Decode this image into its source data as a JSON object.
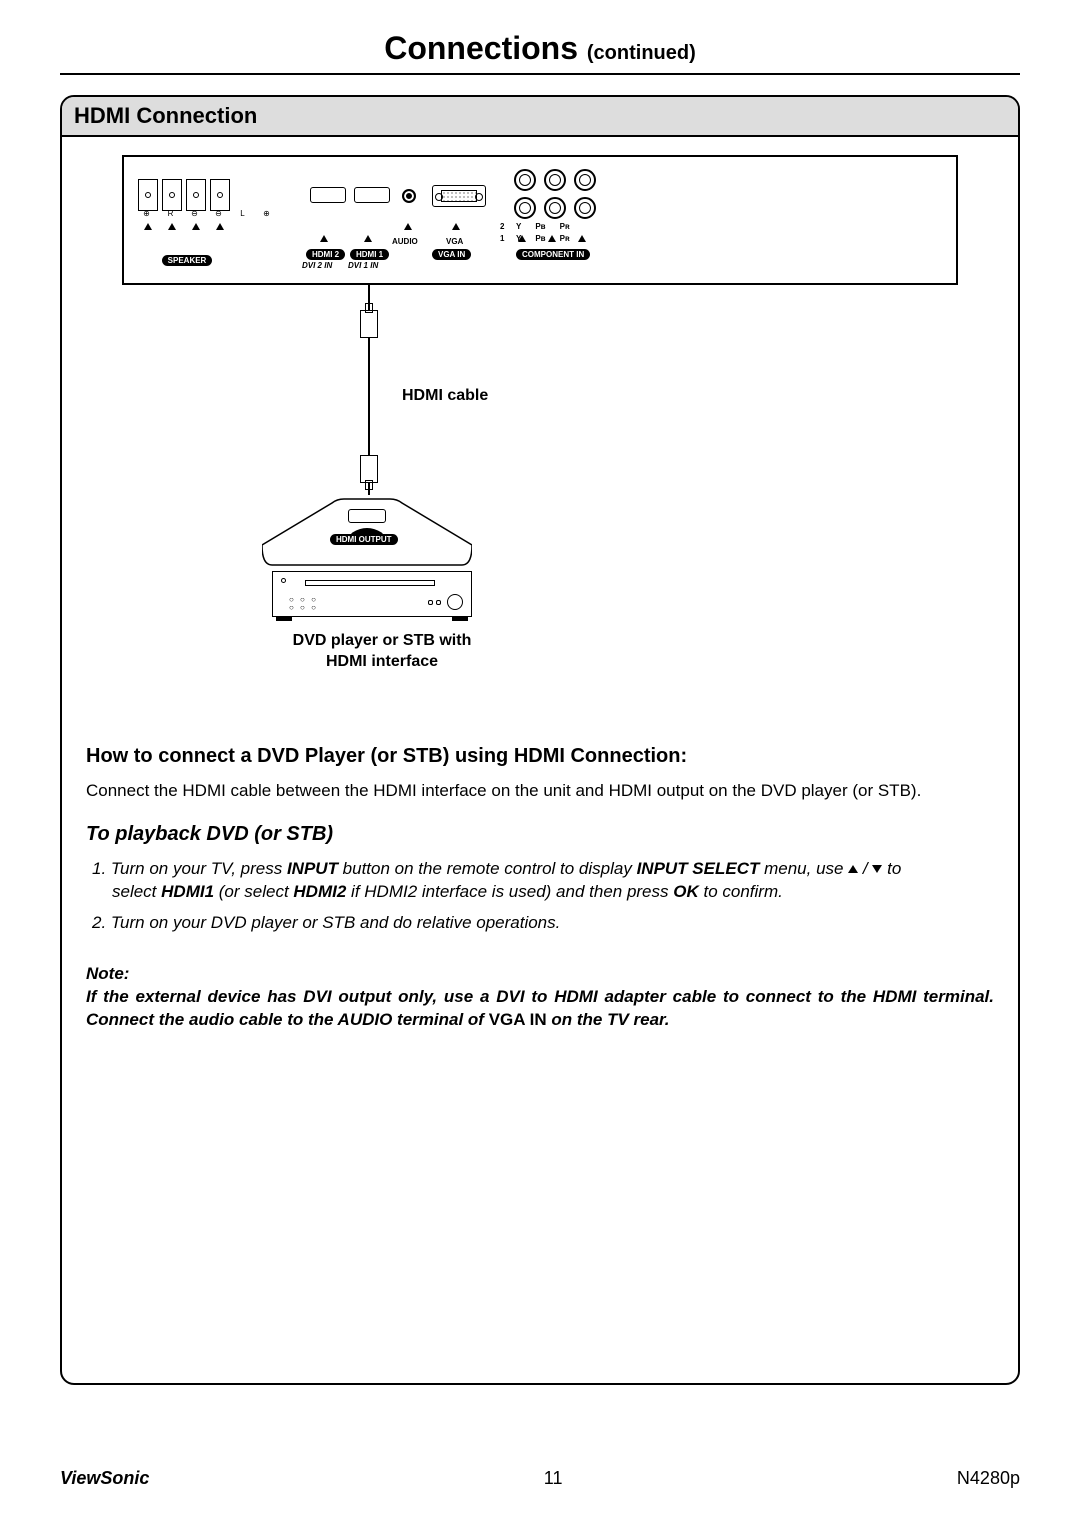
{
  "page": {
    "title_main": "Connections",
    "title_sub": "(continued)"
  },
  "section": {
    "header": "HDMI Connection"
  },
  "diagram": {
    "cable_label": "HDMI cable",
    "hdmi_output_tag": "HDMI OUTPUT",
    "device_label_line1": "DVD player or STB with",
    "device_label_line2": "HDMI interface",
    "ports": {
      "speaker_tag": "SPEAKER",
      "speaker_terminals": [
        "⊕",
        "R",
        "⊖",
        "⊖",
        "L",
        "⊕"
      ],
      "hdmi2_tag": "HDMI 2",
      "hdmi1_tag": "HDMI 1",
      "audio_label": "AUDIO",
      "vga_label": "VGA",
      "vga_in_tag": "VGA IN",
      "component_tag": "COMPONENT IN",
      "dvi2_label": "DVI 2 IN",
      "dvi1_label": "DVI 1 IN",
      "component_rows": [
        "2",
        "1"
      ],
      "component_cols": [
        "Y",
        "Pʙ",
        "Pʀ"
      ]
    }
  },
  "howto": {
    "heading": "How to connect a DVD Player (or STB) using HDMI Connection:",
    "body": "Connect the HDMI cable between the HDMI interface on the unit and HDMI output on the DVD player (or STB)."
  },
  "playback": {
    "heading": "To playback DVD (or STB)",
    "step1_a": "1. Turn on your TV, press ",
    "step1_b": "INPUT",
    "step1_c": " button on the remote control to display ",
    "step1_d": "INPUT SELECT",
    "step1_e": " menu, use ",
    "step1_f": " to",
    "step1_line2_a": "select ",
    "step1_line2_b": "HDMI1",
    "step1_line2_c": " (or select ",
    "step1_line2_d": "HDMI2",
    "step1_line2_e": " if HDMI2 interface is used) and then press ",
    "step1_line2_f": "OK",
    "step1_line2_g": " to confirm.",
    "step2": "2. Turn on your DVD player or STB and do relative operations."
  },
  "note": {
    "label": "Note:",
    "body_a": "If the external device has DVI output only, use a DVI to HDMI adapter cable to connect to the HDMI terminal. Connect the audio cable to the AUDIO terminal of ",
    "body_b": "VGA IN",
    "body_c": " on the TV rear."
  },
  "footer": {
    "brand": "ViewSonic",
    "page_number": "11",
    "model": "N4280p"
  }
}
